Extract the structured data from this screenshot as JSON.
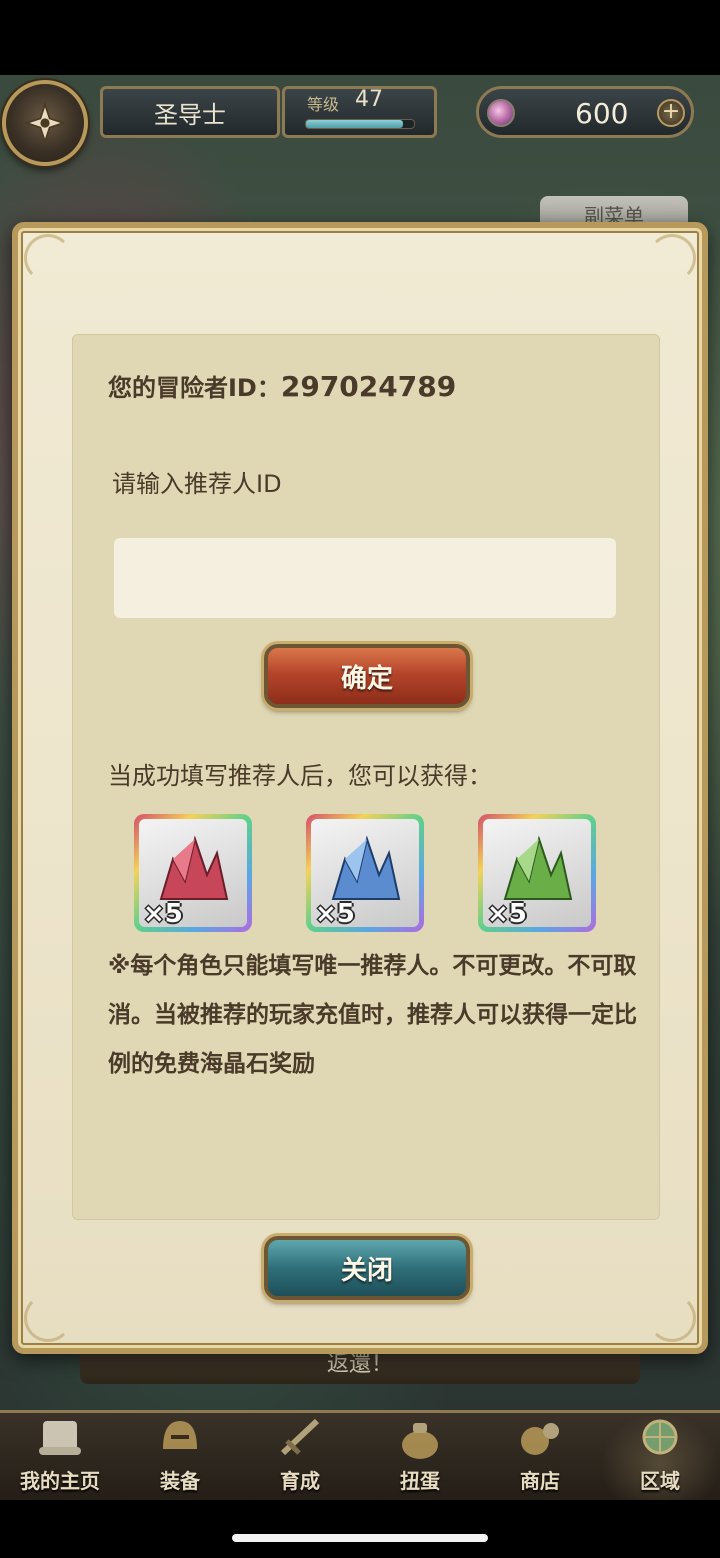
{
  "header": {
    "job_title": "圣导士",
    "level_label": "等级",
    "level_value": "47",
    "level_progress_percent": 90,
    "gem_count": "600",
    "gem_plus": "+",
    "submenu_label": "副菜单"
  },
  "dialog": {
    "id_prefix": "您的冒险者ID：",
    "id_number": "297024789",
    "input_prompt": "请输入推荐人ID",
    "input_value": "",
    "input_placeholder": "",
    "confirm_label": "确定",
    "reward_intro": "当成功填写推荐人后，您可以获得：",
    "rewards": [
      {
        "icon": "red-crystal-icon",
        "color": "#c8465a",
        "count": "×5"
      },
      {
        "icon": "blue-crystal-icon",
        "color": "#5a8ccf",
        "count": "×5"
      },
      {
        "icon": "green-crystal-icon",
        "color": "#6aae48",
        "count": "×5"
      }
    ],
    "note": "※每个角色只能填写唯一推荐人。不可更改。不可取消。当被推荐的玩家充值时，推荐人可以获得一定比例的免费海晶石奖励",
    "close_label": "关闭"
  },
  "background": {
    "banner_text": "返還！"
  },
  "nav": {
    "items": [
      {
        "label": "我的主页",
        "icon": "scroll-icon"
      },
      {
        "label": "装备",
        "icon": "helmet-icon"
      },
      {
        "label": "育成",
        "icon": "sword-icon"
      },
      {
        "label": "扭蛋",
        "icon": "bag-icon"
      },
      {
        "label": "商店",
        "icon": "coin-icon"
      },
      {
        "label": "区域",
        "icon": "globe-icon"
      }
    ]
  },
  "colors": {
    "frame_gold": "#b79a5b",
    "panel_bg": "#e0d8b4",
    "text_brown": "#4a3a2a",
    "confirm_red": "#b5452b",
    "close_teal": "#2f6f7a"
  }
}
